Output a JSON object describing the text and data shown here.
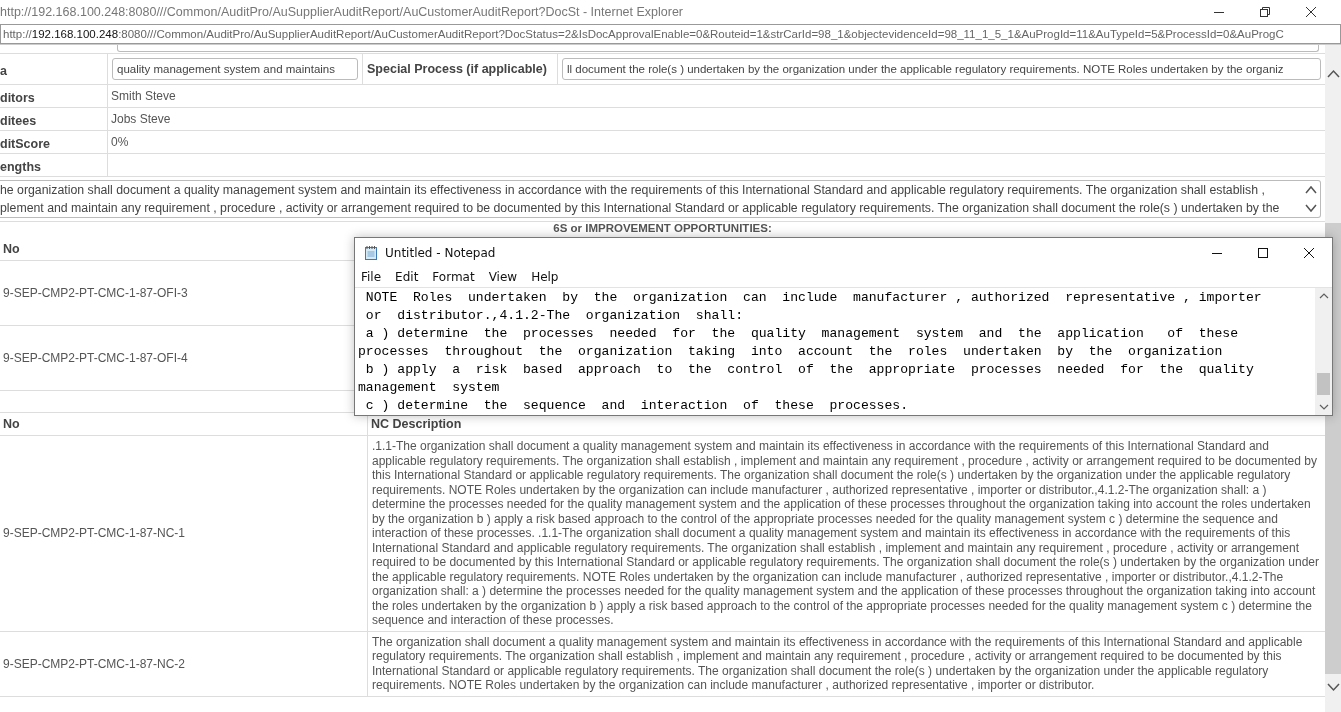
{
  "browser": {
    "title": "http://192.168.100.248:8080///Common/AuditPro/AuSupplierAuditReport/AuCustomerAuditReport?DocSt - Internet Explorer",
    "address": {
      "scheme": "http://",
      "host": "192.168.100.248",
      "rest": ":8080///Common/AuditPro/AuSupplierAuditReport/AuCustomerAuditReport?DocStatus=2&IsDocApprovalEnable=0&Routeid=1&strCarId=98_1&objectevidenceId=98_11_1_5_1&AuProgId=11&AuTypeId=5&ProcessId=0&AuProgC"
    }
  },
  "details": {
    "scope_label": "a",
    "scope_value": "quality management system and maintains",
    "special_label": "Special Process (if applicable)",
    "special_value": "ll document the role(s ) undertaken by the organization under the applicable regulatory requirements. NOTE Roles undertaken by the organiz",
    "rows": [
      {
        "label": "ditors",
        "value": "Smith Steve"
      },
      {
        "label": "ditees",
        "value": "Jobs Steve"
      },
      {
        "label": "ditScore",
        "value": "0%"
      },
      {
        "label": "engths"
      }
    ]
  },
  "strengths_text": [
    "he organization shall document a quality management system and maintain its effectiveness in accordance with the requirements of this International Standard and applicable regulatory requirements. The organization shall establish ,",
    "plement and maintain any requirement , procedure , activity or arrangement required to be documented by this International Standard or applicable regulatory requirements. The organization shall document the role(s ) undertaken by the"
  ],
  "ofi": {
    "title": "6S or IMPROVEMENT OPPORTUNITIES:",
    "columns": [
      "No"
    ],
    "rows": [
      {
        "no": "9-SEP-CMP2-PT-CMC-1-87-OFI-3"
      },
      {
        "no": "9-SEP-CMP2-PT-CMC-1-87-OFI-4"
      }
    ]
  },
  "nc": {
    "columns": [
      "No",
      "NC Description"
    ],
    "rows": [
      {
        "no": "9-SEP-CMP2-PT-CMC-1-87-NC-1",
        "description": ".1.1-The organization shall document a quality management system and maintain its effectiveness in accordance with the requirements of this International Standard and applicable regulatory requirements. The organization shall establish , implement and maintain any requirement , procedure , activity or arrangement required to be documented by this International Standard or applicable regulatory requirements. The organization shall document the role(s ) undertaken by the organization under the applicable regulatory requirements. NOTE Roles undertaken by the organization can include manufacturer , authorized representative , importer or distributor.,4.1.2-The organization shall: a ) determine the processes needed for the quality management system and the application of these processes throughout the organization taking into account the roles undertaken by the organization b ) apply a risk based approach to the control of the appropriate processes needed for the quality management system c ) determine the sequence and interaction of these processes. .1.1-The organization shall document a quality management system and maintain its effectiveness in accordance with the requirements of this International Standard and applicable regulatory requirements. The organization shall establish , implement and maintain any requirement , procedure , activity or arrangement required to be documented by this International Standard or applicable regulatory requirements. The organization shall document the role(s ) undertaken by the organization under the applicable regulatory requirements. NOTE Roles undertaken by the organization can include manufacturer , authorized representative , importer or distributor.,4.1.2-The organization shall: a ) determine the processes needed for the quality management system and the application of these processes throughout the organization taking into account the roles undertaken by the organization b ) apply a risk based approach to the control of the appropriate processes needed for the quality management system c ) determine the sequence and interaction of these processes."
      },
      {
        "no": "9-SEP-CMP2-PT-CMC-1-87-NC-2",
        "description": "The organization shall document a quality management system and maintain its effectiveness in accordance with the requirements of this International Standard and applicable regulatory requirements. The organization shall establish , implement and maintain any requirement , procedure , activity or arrangement required to be documented by this International Standard or applicable regulatory requirements. The organization shall document the role(s ) undertaken by the organization under the applicable regulatory requirements. NOTE Roles undertaken by the organization can include manufacturer , authorized representative , importer or distributor."
      }
    ]
  },
  "notepad": {
    "title": "Untitled - Notepad",
    "menu": [
      "File",
      "Edit",
      "Format",
      "View",
      "Help"
    ],
    "lines": [
      " NOTE  Roles  undertaken  by  the  organization  can  include  manufacturer , authorized  representative , importer",
      " or  distributor.,4.1.2-The  organization  shall:",
      " a ) determine  the  processes  needed  for  the  quality  management  system  and  the  application   of  these",
      "processes  throughout  the  organization  taking  into  account  the  roles  undertaken  by  the  organization",
      " b ) apply  a  risk  based  approach  to  the  control  of  the  appropriate  processes  needed  for  the  quality",
      "management  system",
      " c ) determine  the  sequence  and  interaction  of  these  processes."
    ]
  }
}
